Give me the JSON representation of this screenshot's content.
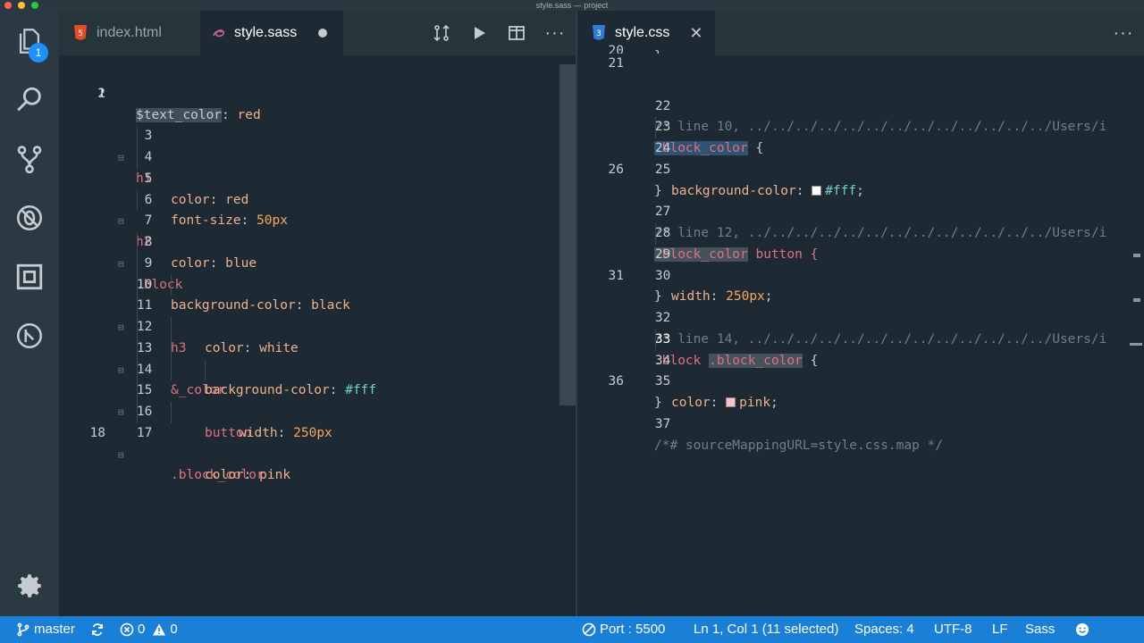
{
  "window": {
    "title": "style.sass — project"
  },
  "activity_bar": {
    "explorer_badge": "1",
    "icons": [
      "files-icon",
      "search-icon",
      "source-control-icon",
      "debug-icon",
      "extensions-icon",
      "remote-icon",
      "gear-icon"
    ]
  },
  "left_group": {
    "tabs": [
      {
        "label": "index.html",
        "icon": "html5-icon",
        "active": false
      },
      {
        "label": "style.sass",
        "icon": "sass-icon",
        "active": true,
        "dirty": true
      }
    ],
    "lines": [
      {
        "n": "1"
      },
      {
        "n": "2"
      },
      {
        "n": "3"
      },
      {
        "n": "4"
      },
      {
        "n": "5"
      },
      {
        "n": "6"
      },
      {
        "n": "7"
      },
      {
        "n": "8"
      },
      {
        "n": "9"
      },
      {
        "n": "10"
      },
      {
        "n": "11"
      },
      {
        "n": "12"
      },
      {
        "n": "13"
      },
      {
        "n": "14"
      },
      {
        "n": "15"
      },
      {
        "n": "16"
      },
      {
        "n": "17"
      },
      {
        "n": "18"
      }
    ],
    "code": {
      "l1_var": "$text_color",
      "l1_rest": ": ",
      "l1_val": "red",
      "l3": "h1",
      "l4_prop": "color",
      "l4_val": "red",
      "l5_prop": "font-size",
      "l5_val": "50px",
      "l6": "h2",
      "l7_prop": "color",
      "l7_val": "blue",
      "l8": ".block",
      "l9_prop": "background-color",
      "l9_val": "black",
      "l10": "h3",
      "l11_prop": "color",
      "l11_val": "white",
      "l12": "&_color",
      "l13_prop": "background-color",
      "l13_val": "#fff",
      "l14": "button",
      "l15_prop": "width",
      "l15_val": "250px",
      "l16": ".block_color",
      "l17_prop": "color",
      "l17_val": "pink"
    }
  },
  "right_group": {
    "tabs": [
      {
        "label": "style.css",
        "icon": "css3-icon",
        "active": true
      }
    ],
    "lines": [
      {
        "n": "20"
      },
      {
        "n": "21"
      },
      {
        "n": "22"
      },
      {
        "n": "23"
      },
      {
        "n": "24"
      },
      {
        "n": "25"
      },
      {
        "n": "26"
      },
      {
        "n": "27"
      },
      {
        "n": "28"
      },
      {
        "n": "29"
      },
      {
        "n": "30"
      },
      {
        "n": "31"
      },
      {
        "n": "32"
      },
      {
        "n": "33"
      },
      {
        "n": "34"
      },
      {
        "n": "35"
      },
      {
        "n": "36"
      },
      {
        "n": "37"
      }
    ],
    "code": {
      "l20": "}",
      "l22": "/* line 10, ../../../../../../../../../../../../../Users/i",
      "l23_sel": ".block_color",
      "l23_rest": " {",
      "l24_prop": "background-color",
      "l24_val": "#fff",
      "l25": "}",
      "l27": "/* line 12, ../../../../../../../../../../../../../Users/i",
      "l28_sel": ".block_color",
      "l28_rest": " button {",
      "l29_prop": "width",
      "l29_val": "250px",
      "l30": "}",
      "l32": "/* line 14, ../../../../../../../../../../../../../Users/i",
      "l33_a": ".block ",
      "l33_sel": ".block_color",
      "l33_rest": " {",
      "l34_prop": "color",
      "l34_val": "pink",
      "l35": "}",
      "l37": "/*# sourceMappingURL=style.css.map */"
    }
  },
  "status_bar": {
    "branch": "master",
    "errors": "0",
    "warnings": "0",
    "port": "Port : 5500",
    "cursor": "Ln 1, Col 1 (11 selected)",
    "spaces": "Spaces: 4",
    "encoding": "UTF-8",
    "eol": "LF",
    "language": "Sass"
  },
  "colors": {
    "status_bg": "#1a7fd6",
    "editor_bg": "#1e2a33",
    "activity_bg": "#2a3942"
  }
}
